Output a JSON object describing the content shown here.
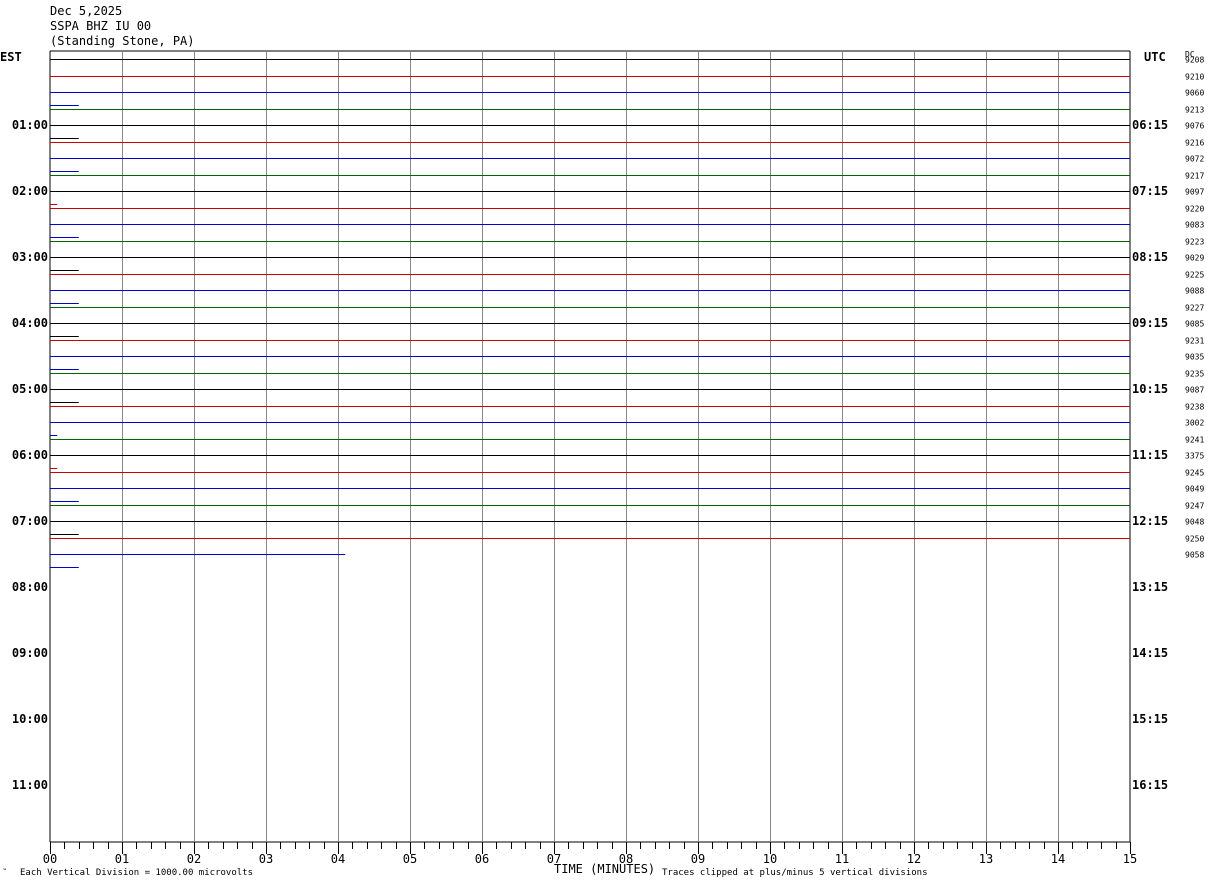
{
  "header": {
    "date": "Dec 5,2025",
    "station": "SSPA BHZ IU 00",
    "location": "(Standing Stone, PA)"
  },
  "footer": {
    "scale_note": "Each Vertical Division = 1000.00 microvolts",
    "xlabel": "TIME (MINUTES)",
    "clip_note": "Traces clipped at plus/minus 5 vertical divisions",
    "corner_mark": "‶"
  },
  "chart_data": {
    "type": "line",
    "title": "SSPA BHZ IU 00",
    "xlabel": "TIME (MINUTES)",
    "xlim": [
      0,
      15
    ],
    "x_ticks": [
      "00",
      "01",
      "02",
      "03",
      "04",
      "05",
      "06",
      "07",
      "08",
      "09",
      "10",
      "11",
      "12",
      "13",
      "14",
      "15"
    ],
    "left_axis_label": "EST",
    "right_axis_label": "UTC",
    "dc_label": "DC",
    "grid": true,
    "hour_rows": [
      {
        "est": "01:00",
        "utc": "06:15"
      },
      {
        "est": "02:00",
        "utc": "07:15"
      },
      {
        "est": "03:00",
        "utc": "08:15"
      },
      {
        "est": "04:00",
        "utc": "09:15"
      },
      {
        "est": "05:00",
        "utc": "10:15"
      },
      {
        "est": "06:00",
        "utc": "11:15"
      },
      {
        "est": "07:00",
        "utc": "12:15"
      },
      {
        "est": "08:00",
        "utc": "13:15"
      },
      {
        "est": "09:00",
        "utc": "14:15"
      },
      {
        "est": "10:00",
        "utc": "15:15"
      },
      {
        "est": "11:00",
        "utc": "16:15"
      }
    ],
    "trace_colors": [
      "#000000",
      "#cc0000",
      "#0000cc",
      "#006600"
    ],
    "traces": [
      {
        "color": "#000000",
        "dc": "9208",
        "end_min": 15
      },
      {
        "color": "#cc0000",
        "dc": "9210",
        "end_min": 15
      },
      {
        "color": "#0000cc",
        "dc": "9060",
        "end_min": 15
      },
      {
        "color": "#006600",
        "dc": "9213",
        "end_min": 15
      },
      {
        "color": "#000000",
        "dc": "9076",
        "end_min": 15
      },
      {
        "color": "#cc0000",
        "dc": "9216",
        "end_min": 15
      },
      {
        "color": "#0000cc",
        "dc": "9072",
        "end_min": 15
      },
      {
        "color": "#006600",
        "dc": "9217",
        "end_min": 15
      },
      {
        "color": "#000000",
        "dc": "9097",
        "end_min": 15
      },
      {
        "color": "#cc0000",
        "dc": "9220",
        "end_min": 15
      },
      {
        "color": "#0000cc",
        "dc": "9083",
        "end_min": 15
      },
      {
        "color": "#006600",
        "dc": "9223",
        "end_min": 15
      },
      {
        "color": "#000000",
        "dc": "9029",
        "end_min": 15
      },
      {
        "color": "#cc0000",
        "dc": "9225",
        "end_min": 15
      },
      {
        "color": "#0000cc",
        "dc": "9088",
        "end_min": 15
      },
      {
        "color": "#006600",
        "dc": "9227",
        "end_min": 15
      },
      {
        "color": "#000000",
        "dc": "9085",
        "end_min": 15
      },
      {
        "color": "#cc0000",
        "dc": "9231",
        "end_min": 15
      },
      {
        "color": "#0000cc",
        "dc": "9035",
        "end_min": 15
      },
      {
        "color": "#006600",
        "dc": "9235",
        "end_min": 15
      },
      {
        "color": "#000000",
        "dc": "9087",
        "end_min": 15
      },
      {
        "color": "#cc0000",
        "dc": "9238",
        "end_min": 15
      },
      {
        "color": "#0000cc",
        "dc": "3002",
        "end_min": 15
      },
      {
        "color": "#006600",
        "dc": "9241",
        "end_min": 15
      },
      {
        "color": "#000000",
        "dc": "3375",
        "end_min": 15
      },
      {
        "color": "#cc0000",
        "dc": "9245",
        "end_min": 15
      },
      {
        "color": "#0000cc",
        "dc": "9049",
        "end_min": 15
      },
      {
        "color": "#006600",
        "dc": "9247",
        "end_min": 15
      },
      {
        "color": "#000000",
        "dc": "9048",
        "end_min": 15
      },
      {
        "color": "#cc0000",
        "dc": "9250",
        "end_min": 15
      },
      {
        "color": "#0000cc",
        "dc": "9058",
        "end_min": 4.1
      }
    ],
    "dc_sub_marks": [
      {
        "color": "#0000cc",
        "offset_min": 0.4
      },
      {
        "color": "#000000",
        "offset_min": 0.4
      },
      {
        "color": "#0000cc",
        "offset_min": 0.4
      },
      {
        "color": "#cc0000",
        "offset_min": 0.1
      },
      {
        "color": "#0000cc",
        "offset_min": 0.4
      },
      {
        "color": "#000000",
        "offset_min": 0.4
      },
      {
        "color": "#0000cc",
        "offset_min": 0.4
      },
      {
        "color": "#000000",
        "offset_min": 0.4
      },
      {
        "color": "#0000cc",
        "offset_min": 0.4
      },
      {
        "color": "#000000",
        "offset_min": 0.4
      },
      {
        "color": "#0000cc",
        "offset_min": 0.1
      },
      {
        "color": "#cc0000",
        "offset_min": 0.1
      },
      {
        "color": "#0000cc",
        "offset_min": 0.4
      },
      {
        "color": "#000000",
        "offset_min": 0.4
      },
      {
        "color": "#0000cc",
        "offset_min": 0.4
      }
    ]
  }
}
